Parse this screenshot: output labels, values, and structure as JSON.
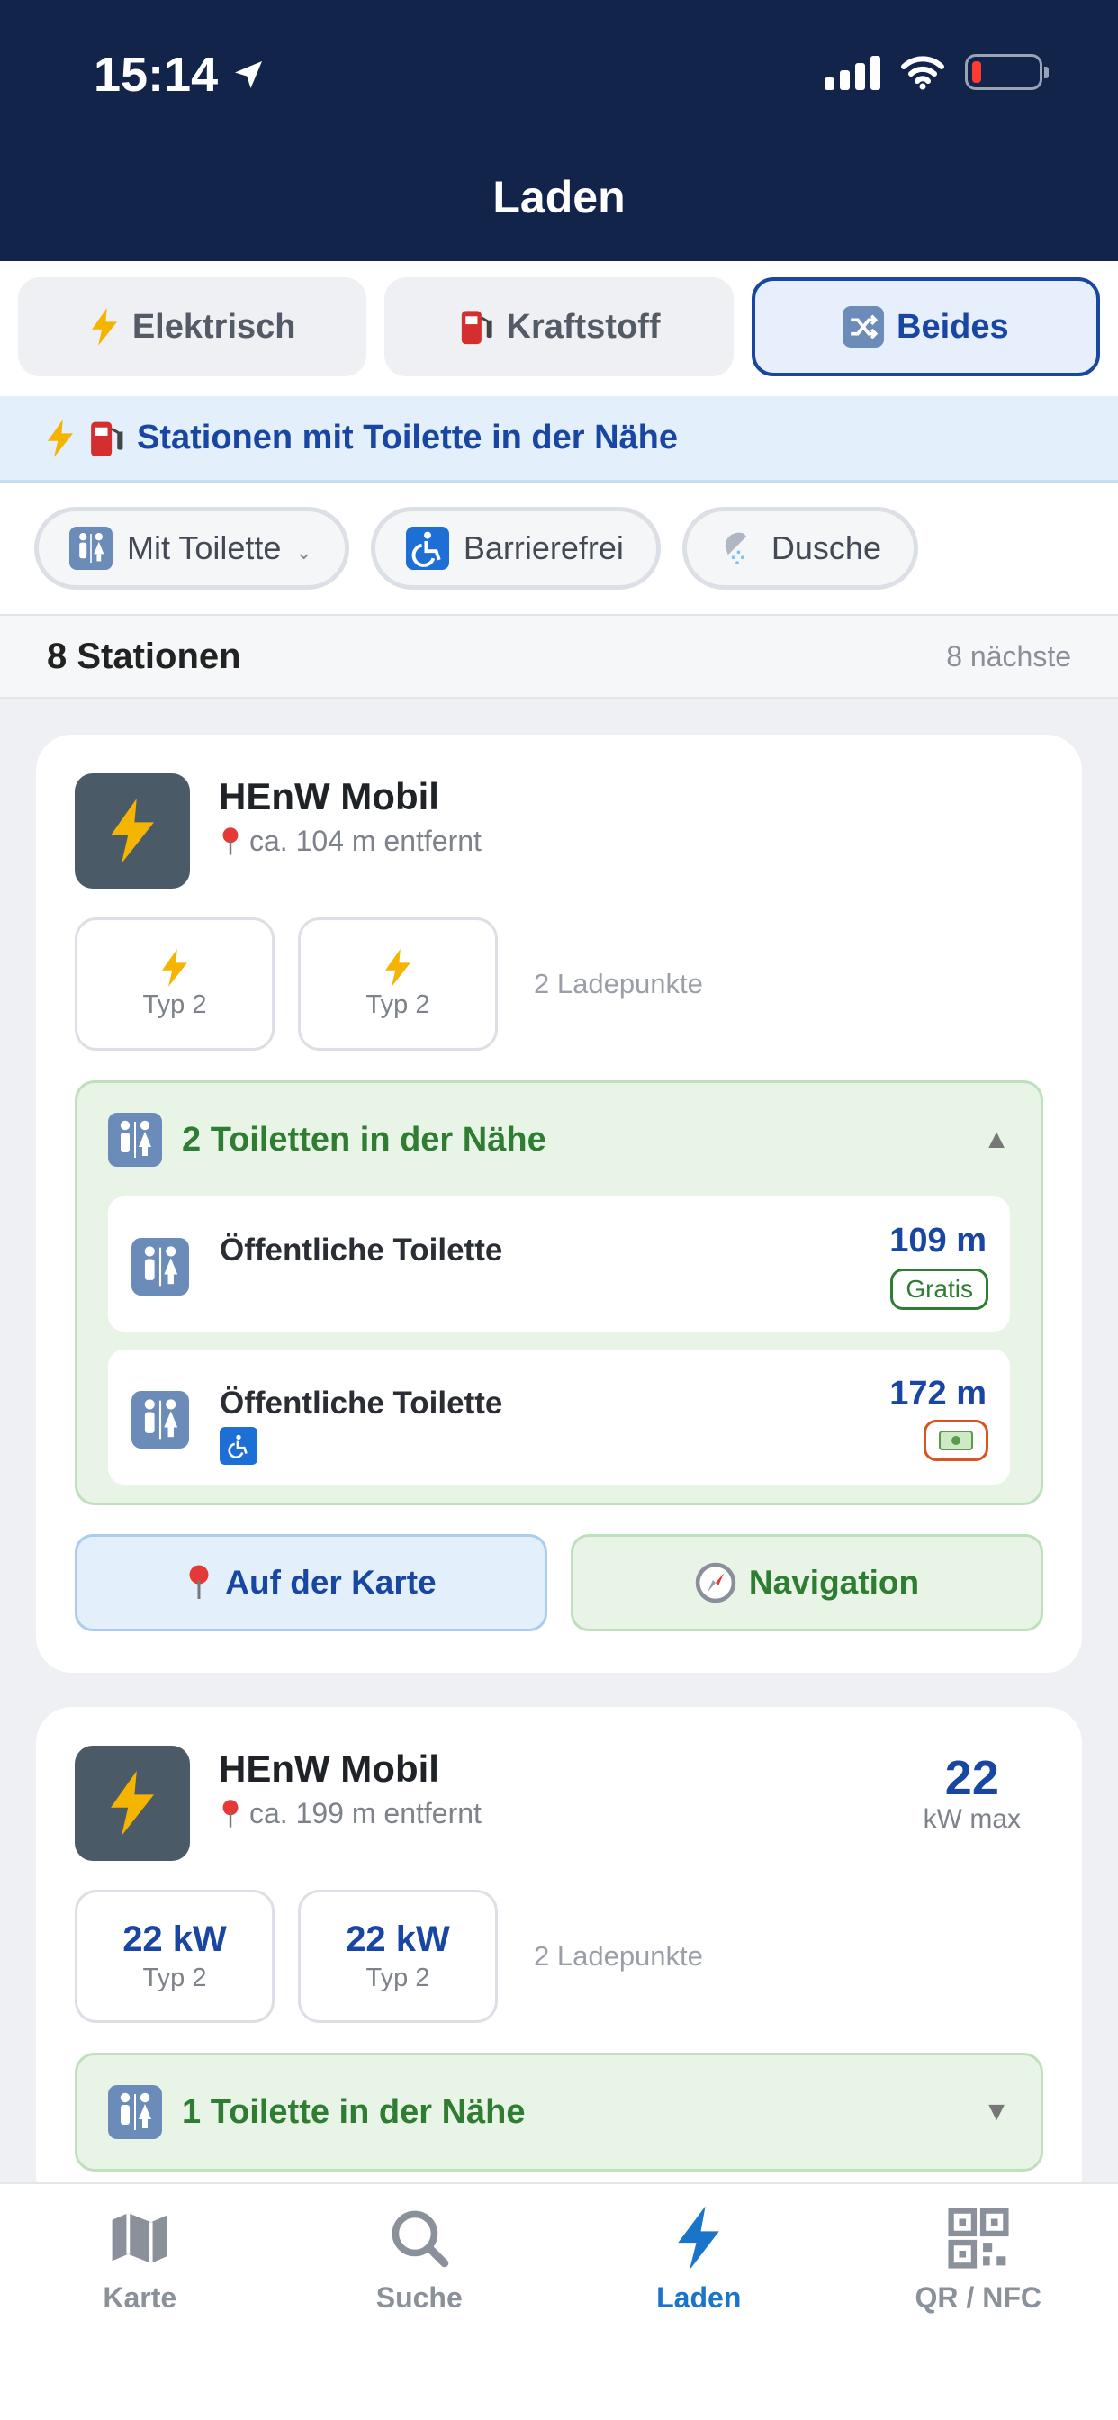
{
  "status": {
    "time": "15:14"
  },
  "header": {
    "title": "Laden"
  },
  "segments": [
    {
      "label": "Elektrisch",
      "icon": "lightning-icon"
    },
    {
      "label": "Kraftstoff",
      "icon": "fuel-pump-icon"
    },
    {
      "label": "Beides",
      "icon": "shuffle-icon",
      "active": true
    }
  ],
  "banner": {
    "text": "Stationen mit Toilette in der Nähe"
  },
  "filters": [
    {
      "label": "Mit Toilette",
      "icon": "restroom-icon",
      "has_dropdown": true
    },
    {
      "label": "Barrierefrei",
      "icon": "wheelchair-icon"
    },
    {
      "label": "Dusche",
      "icon": "shower-icon"
    }
  ],
  "results": {
    "count": "8 Stationen",
    "sort": "8 nächste"
  },
  "stations": [
    {
      "name": "HEnW Mobil",
      "distance": "ca. 104 m entfernt",
      "plugs": [
        {
          "type": "Typ 2"
        },
        {
          "type": "Typ 2"
        }
      ],
      "plug_count": "2 Ladepunkte",
      "toilets_header": "2 Toiletten in der Nähe",
      "toilets": [
        {
          "name": "Öffentliche Toilette",
          "distance": "109 m",
          "badge": "Gratis"
        },
        {
          "name": "Öffentliche Toilette",
          "distance": "172 m",
          "badge_icon": "money-icon",
          "accessible": true
        }
      ],
      "actions": {
        "map": "Auf der Karte",
        "navigation": "Navigation"
      }
    },
    {
      "name": "HEnW Mobil",
      "distance": "ca. 199 m entfernt",
      "max_kw": "22",
      "max_kw_unit": "kW max",
      "plugs": [
        {
          "kw": "22 kW",
          "type": "Typ 2"
        },
        {
          "kw": "22 kW",
          "type": "Typ 2"
        }
      ],
      "plug_count": "2 Ladepunkte",
      "toilets_header": "1 Toilette in der Nähe"
    }
  ],
  "tabbar": [
    {
      "label": "Karte",
      "icon": "map-icon"
    },
    {
      "label": "Suche",
      "icon": "search-icon"
    },
    {
      "label": "Laden",
      "icon": "lightning-icon",
      "active": true
    },
    {
      "label": "QR / NFC",
      "icon": "qr-code-icon"
    }
  ],
  "colors": {
    "header_bg": "#13244a",
    "accent_blue": "#1a46a3",
    "toilet_green": "#2e7d32",
    "active_tab": "#1a74c9"
  }
}
